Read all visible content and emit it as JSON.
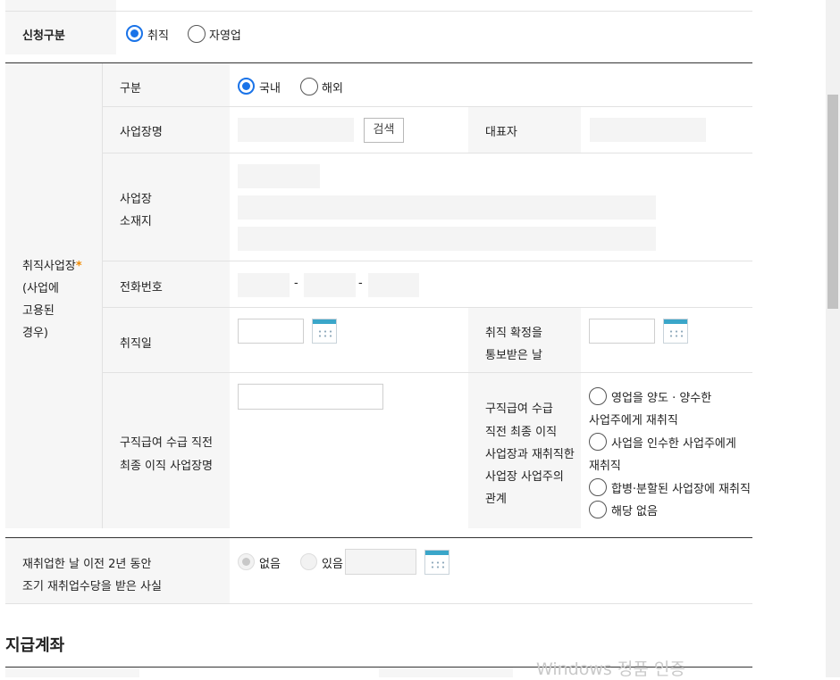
{
  "application_type": {
    "label": "신청구분",
    "options": [
      {
        "label": "취직",
        "selected": true
      },
      {
        "label": "자영업",
        "selected": false
      }
    ]
  },
  "workplace": {
    "section_label": "취직사업장",
    "required_mark": "*",
    "section_note_lines": [
      "(사업에",
      "고용된",
      "경우)"
    ],
    "division": {
      "label": "구분",
      "options": [
        {
          "label": "국내",
          "selected": true
        },
        {
          "label": "해외",
          "selected": false
        }
      ]
    },
    "name_label": "사업장명",
    "search_button": "검색",
    "representative_label": "대표자",
    "address_label_lines": [
      "사업장",
      "소재지"
    ],
    "phone_label": "전화번호",
    "phone_separator": "-",
    "employment_date_label": "취직일",
    "confirm_date_label_lines": [
      "취직 확정을",
      "통보받은 날"
    ],
    "last_workplace_label_lines": [
      "구직급여 수급 직전",
      "최종 이직 사업장명"
    ],
    "relation_label_lines": [
      "구직급여 수급",
      "직전 최종 이직",
      "사업장과 재취직한",
      "사업장 사업주의",
      "관계"
    ],
    "relation_options": [
      {
        "lines": [
          "영업을 양도 · 양수한",
          "사업주에게 재취직"
        ]
      },
      {
        "lines": [
          "사업을 인수한 사업주에게",
          "재취직"
        ]
      },
      {
        "lines": [
          "합병·분할된 사업장에 재취직"
        ]
      },
      {
        "lines": [
          "해당 없음"
        ]
      }
    ]
  },
  "early_allowance": {
    "label_lines": [
      "재취업한 날 이전 2년 동안",
      "조기 재취업수당을 받은 사실"
    ],
    "options": [
      {
        "label": "없음",
        "selected": true
      },
      {
        "label": "있음",
        "selected": false
      }
    ]
  },
  "payment_account": {
    "heading": "지급계좌"
  },
  "watermark": "Windows 정품 인증",
  "colors": {
    "accent": "#1a73e8",
    "required": "#f08a00",
    "label_bg": "#f6f6f6",
    "calendar": "#3aa6c9"
  }
}
